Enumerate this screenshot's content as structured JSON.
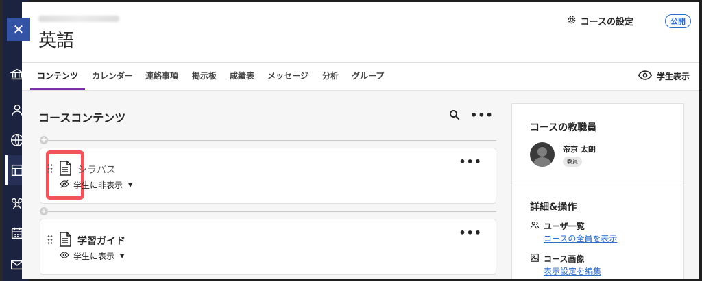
{
  "course": {
    "title": "英語",
    "settings_label": "コースの設定",
    "visibility_badge": "公開"
  },
  "tabs": [
    {
      "label": "コンテンツ"
    },
    {
      "label": "カレンダー"
    },
    {
      "label": "連絡事項"
    },
    {
      "label": "掲示板"
    },
    {
      "label": "成績表"
    },
    {
      "label": "メッセージ"
    },
    {
      "label": "分析"
    },
    {
      "label": "グループ"
    }
  ],
  "student_view_label": "学生表示",
  "content": {
    "title": "コースコンテンツ",
    "items": [
      {
        "title": "シラバス",
        "status": "学生に非表示"
      },
      {
        "title": "学習ガイド",
        "status": "学生に表示"
      }
    ]
  },
  "sidebar": {
    "instructors_title": "コースの教職員",
    "instructor_name": "帝京 太朗",
    "instructor_role": "教員",
    "details_title": "詳細&操作",
    "roster_label": "ユーザ一覧",
    "roster_link": "コースの全員を表示",
    "image_label": "コース画像",
    "image_link": "表示設定を編集"
  },
  "icons": {
    "close": "close-icon",
    "gear": "gear-icon",
    "eye": "eye-icon",
    "eye_slash": "eye-slash-icon",
    "document": "document-icon",
    "search": "search-icon",
    "more": "more-icon"
  },
  "colors": {
    "accent_tab": "#7b2fa8",
    "link": "#2b6ec9",
    "highlight": "#f2545b",
    "rail": "#1c2340",
    "close_tab": "#3553a4"
  }
}
